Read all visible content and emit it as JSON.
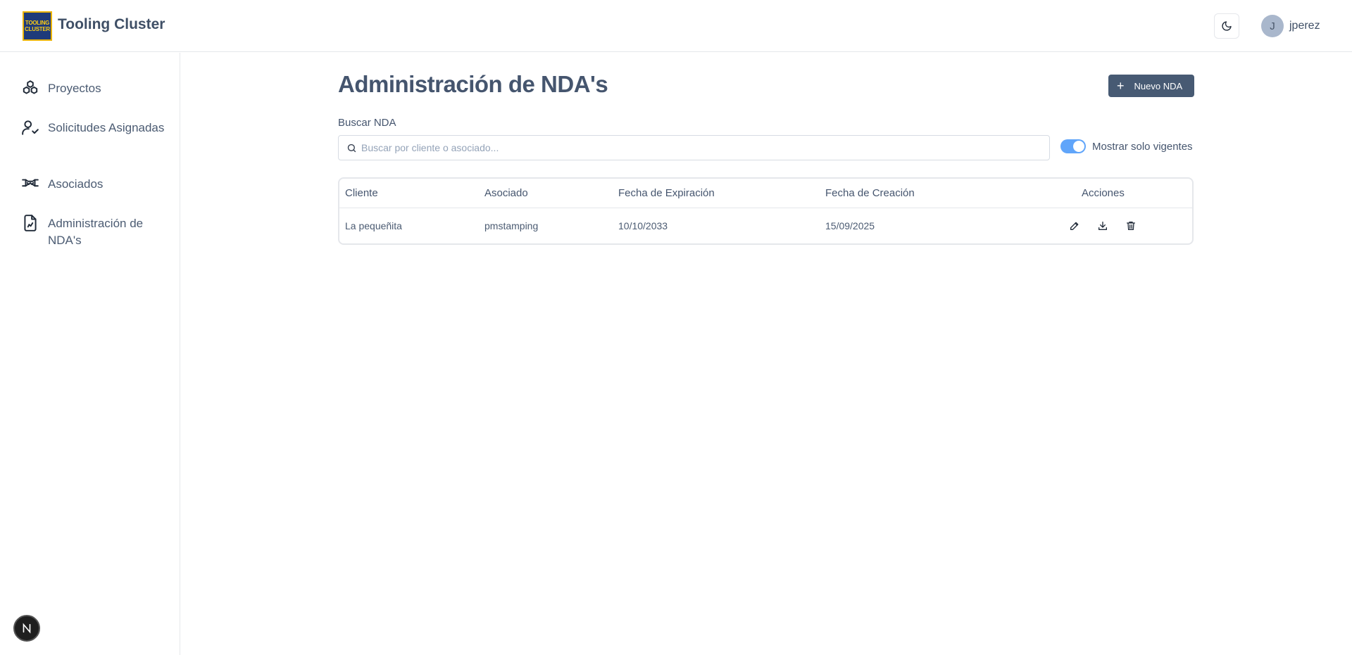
{
  "header": {
    "logo_text": [
      "TOOLING",
      "CLUSTER"
    ],
    "app_title": "Tooling Cluster",
    "theme_icon": "moon-icon",
    "avatar_initial": "J",
    "username": "jperez"
  },
  "sidebar": {
    "items": [
      {
        "label": "Proyectos",
        "icon": "projects-icon"
      },
      {
        "label": "Solicitudes Asignadas",
        "icon": "user-check-icon"
      },
      {
        "label": "Asociados",
        "icon": "handshake-icon"
      },
      {
        "label": "Administración de NDA's",
        "icon": "file-signature-icon"
      }
    ],
    "badge": "N"
  },
  "main": {
    "title": "Administración de NDA's",
    "new_button": {
      "icon": "plus-icon",
      "label": "Nuevo NDA"
    },
    "search": {
      "label": "Buscar NDA",
      "placeholder": "Buscar por cliente o asociado...",
      "value": ""
    },
    "toggle": {
      "label": "Mostrar solo vigentes",
      "on": true
    }
  },
  "table": {
    "columns": [
      "Cliente",
      "Asociado",
      "Fecha de Expiración",
      "Fecha de Creación",
      "Acciones"
    ],
    "rows": [
      {
        "cliente": "La pequeñita",
        "asociado": "pmstamping",
        "expiracion": "10/10/2033",
        "creacion": "15/09/2025"
      }
    ],
    "row_actions": [
      "edit-icon",
      "download-icon",
      "trash-icon"
    ]
  },
  "colors": {
    "primary_button": "#475a73",
    "toggle_on": "#60a5fa",
    "logo_bg": "#1e3a7a",
    "logo_accent": "#facc15"
  }
}
